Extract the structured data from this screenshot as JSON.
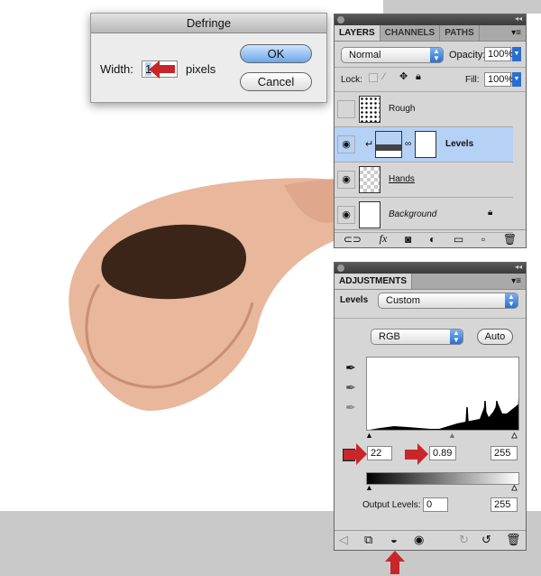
{
  "dialog": {
    "title": "Defringe",
    "width_label": "Width:",
    "width_value": "1",
    "unit": "pixels",
    "ok": "OK",
    "cancel": "Cancel"
  },
  "layers_panel": {
    "tabs": [
      "LAYERS",
      "CHANNELS",
      "PATHS"
    ],
    "blend_mode": "Normal",
    "opacity_label": "Opacity:",
    "opacity": "100%",
    "lock_label": "Lock:",
    "fill_label": "Fill:",
    "fill": "100%",
    "layers": [
      {
        "name": "Rough",
        "visible": false
      },
      {
        "name": "Levels",
        "visible": true,
        "selected": true
      },
      {
        "name": "Hands",
        "visible": true
      },
      {
        "name": "Background",
        "visible": true,
        "locked": true
      }
    ]
  },
  "adjustments_panel": {
    "tab": "ADJUSTMENTS",
    "type_label": "Levels",
    "preset": "Custom",
    "channel": "RGB",
    "auto": "Auto",
    "input_black": "22",
    "input_gamma": "0.89",
    "input_white": "255",
    "output_label": "Output Levels:",
    "output_black": "0",
    "output_white": "255"
  },
  "colors": {
    "accent": "#c8262a",
    "selected_layer": "#b5d1f5"
  }
}
